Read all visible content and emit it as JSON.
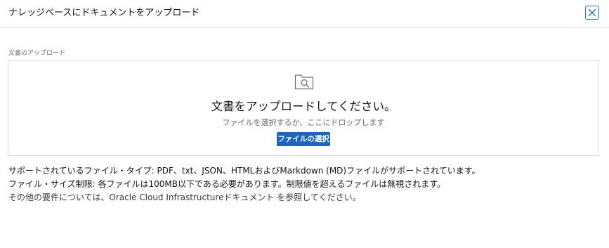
{
  "dialog": {
    "title": "ナレッジベースにドキュメントをアップロード",
    "close_icon": "close-icon",
    "accent_color": "#227e9e"
  },
  "upload": {
    "label": "文書のアップロード",
    "icon": "folder-search-icon",
    "title": "文書をアップロードしてください。",
    "subtitle": "ファイルを選択するか、ここにドロップします",
    "button_label": "ファイルの選択",
    "button_color": "#1a64c4"
  },
  "info": {
    "line1": "サポートされているファイル・タイプ: PDF、txt、JSON、HTMLおよびMarkdown (MD)ファイルがサポートされています。",
    "line2": "ファイル・サイズ制限: 各ファイルは100MB以下である必要があります。制限値を超えるファイルは無視されます。",
    "line3": "その他の要件については、Oracle Cloud Infrastructureドキュメント を参照してください。"
  }
}
